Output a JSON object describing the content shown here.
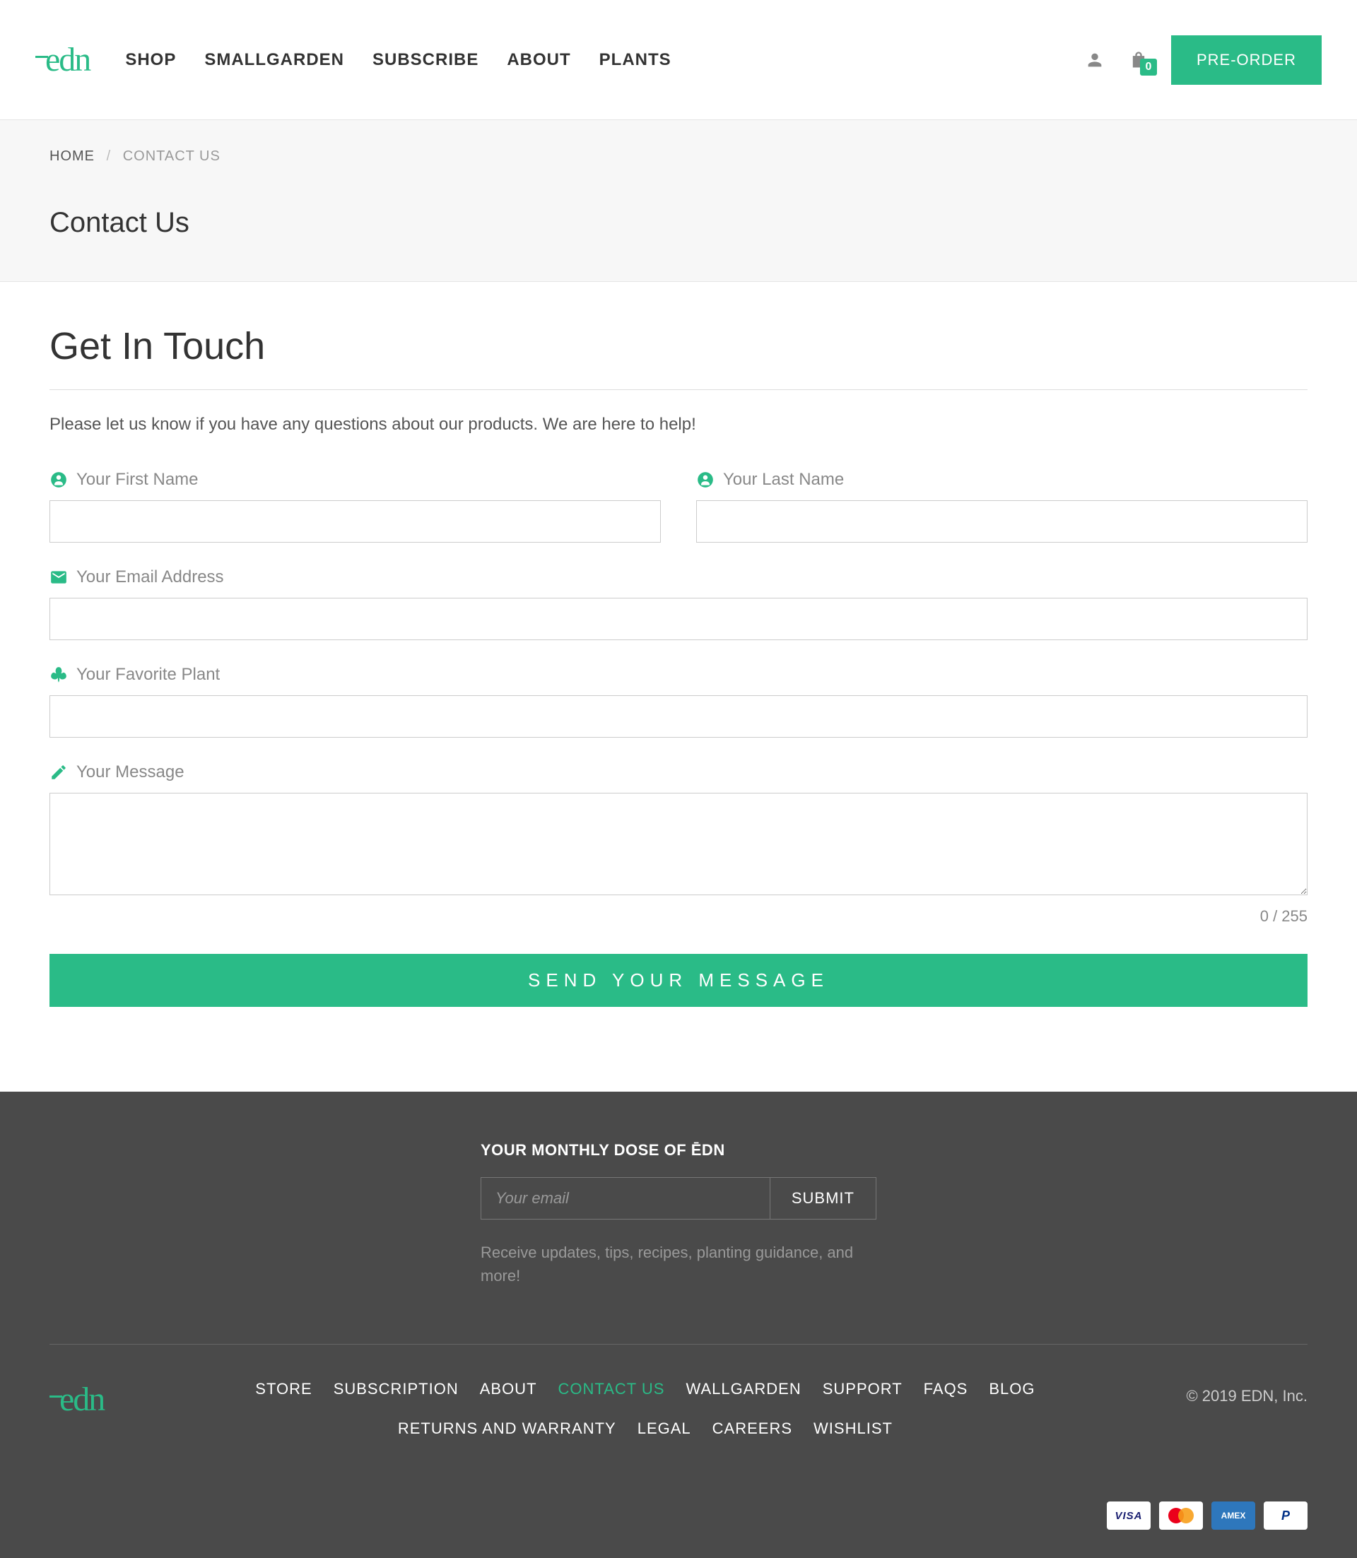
{
  "header": {
    "logo": "ēdn",
    "nav": [
      "SHOP",
      "SMALLGARDEN",
      "SUBSCRIBE",
      "ABOUT",
      "PLANTS"
    ],
    "cart_count": "0",
    "preorder": "PRE-ORDER"
  },
  "breadcrumb": {
    "home": "HOME",
    "sep": "/",
    "current": "CONTACT US",
    "title": "Contact Us"
  },
  "main": {
    "title": "Get In Touch",
    "intro": "Please let us know if you have any questions about our products. We are here to help!",
    "labels": {
      "first_name": "Your First Name",
      "last_name": "Your Last Name",
      "email": "Your Email Address",
      "plant": "Your Favorite Plant",
      "message": "Your Message"
    },
    "counter": "0 / 255",
    "submit": "SEND YOUR MESSAGE"
  },
  "footer": {
    "newsletter_title": "YOUR MONTHLY DOSE OF ĒDN",
    "email_placeholder": "Your email",
    "submit": "SUBMIT",
    "desc": "Receive updates, tips, recipes, planting guidance, and more!",
    "logo": "ēdn",
    "nav": [
      "STORE",
      "SUBSCRIPTION",
      "ABOUT",
      "CONTACT US",
      "WALLGARDEN",
      "SUPPORT",
      "FAQS",
      "BLOG",
      "RETURNS AND WARRANTY",
      "LEGAL",
      "CAREERS",
      "WISHLIST"
    ],
    "active_nav": "CONTACT US",
    "copyright": "© 2019 EDN, Inc.",
    "cards": {
      "visa": "VISA",
      "amex": "AMEX",
      "paypal": "P"
    }
  }
}
